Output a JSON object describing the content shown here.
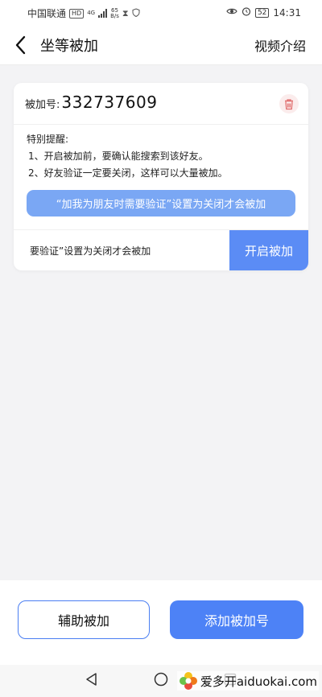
{
  "status_bar": {
    "carrier": "中国联通",
    "hd": "HD",
    "net_type": "4G",
    "speed_value": "65",
    "speed_unit": "B/s",
    "battery": "52",
    "time": "14:31"
  },
  "nav": {
    "title": "坐等被加",
    "right_link": "视频介绍"
  },
  "card": {
    "id_label": "被加号:",
    "id_value": "332737609",
    "notice_title": "特别提醒:",
    "notice_items": [
      "1、开启被加前，要确认能搜索到该好友。",
      "2、好友验证一定要关闭，这样可以大量被加。"
    ],
    "tip_text": "“加我为朋友时需要验证”设置为关闭才会被加",
    "marquee_text": "要验证”设置为关闭才会被加",
    "start_button": "开启被加"
  },
  "bottom": {
    "assist_button": "辅助被加",
    "add_button": "添加被加号"
  },
  "watermark": {
    "text": "爱多开aiduokai.com"
  },
  "colors": {
    "primary": "#4d82f6",
    "tip_pill": "#7aa7f4",
    "delete_icon": "#e06b6b"
  }
}
